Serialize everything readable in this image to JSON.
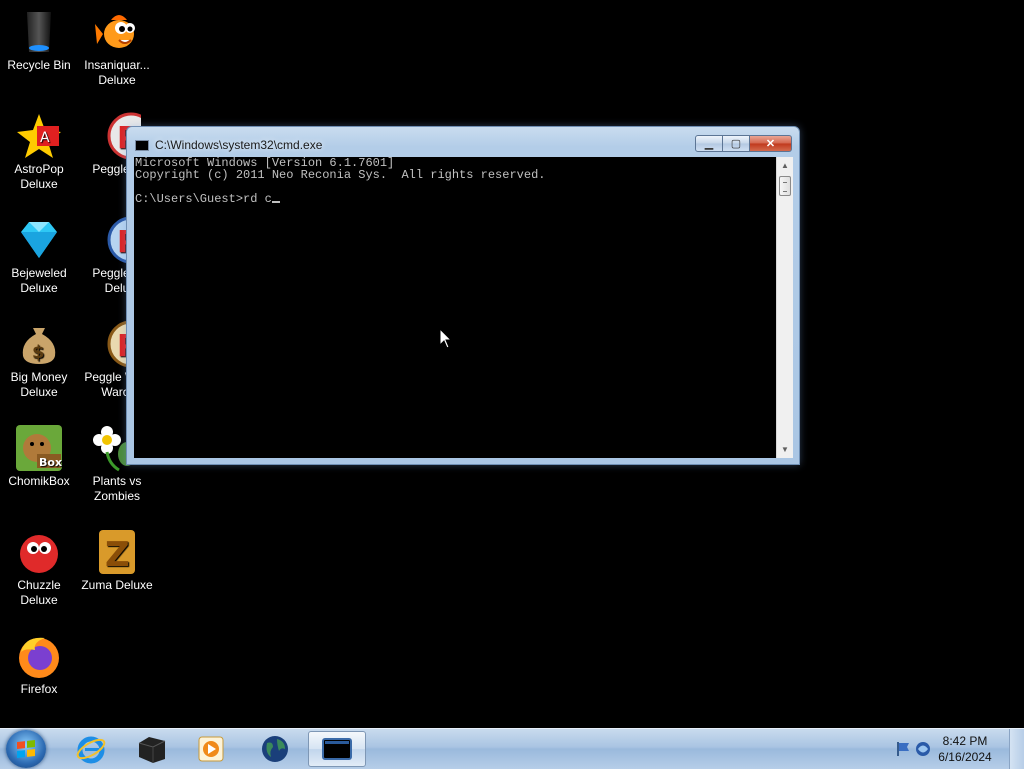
{
  "desktop": {
    "icons": [
      {
        "label": "Recycle Bin",
        "icon": "recycle-bin-icon"
      },
      {
        "label": "Insaniquar... Deluxe",
        "icon": "goldfish-icon"
      },
      {
        "label": "AstroPop Deluxe",
        "icon": "astropop-icon"
      },
      {
        "label": "Peggle D",
        "icon": "peggle-icon"
      },
      {
        "label": "Bejeweled Deluxe",
        "icon": "diamond-icon"
      },
      {
        "label": "Peggle N Delu",
        "icon": "peggle-nights-icon"
      },
      {
        "label": "Big Money Deluxe",
        "icon": "money-bag-icon"
      },
      {
        "label": "Peggle W of Warcr",
        "icon": "peggle-wow-icon"
      },
      {
        "label": "ChomikBox",
        "icon": "hamster-box-icon"
      },
      {
        "label": "Plants vs Zombies",
        "icon": "flower-icon"
      },
      {
        "label": "Chuzzle Deluxe",
        "icon": "chuzzle-icon"
      },
      {
        "label": "Zuma Deluxe",
        "icon": "zuma-icon"
      },
      {
        "label": "Firefox",
        "icon": "firefox-icon"
      }
    ]
  },
  "cmd_window": {
    "title": "C:\\Windows\\system32\\cmd.exe",
    "lines": [
      "Microsoft Windows [Version 6.1.7601]",
      "Copyright (c) 2011 Neo Reconia Sys.  All rights reserved.",
      "",
      "C:\\Users\\Guest>rd c"
    ],
    "buttons": {
      "minimize": "minimize",
      "maximize": "maximize",
      "close": "close"
    }
  },
  "taskbar": {
    "items": [
      {
        "name": "internet-explorer",
        "icon": "ie-icon"
      },
      {
        "name": "dark-app",
        "icon": "box-icon"
      },
      {
        "name": "media-player",
        "icon": "media-player-icon"
      },
      {
        "name": "globe-app",
        "icon": "globe-icon"
      },
      {
        "name": "cmd",
        "icon": "cmd-icon",
        "active": true
      }
    ],
    "clock": {
      "time": "8:42 PM",
      "date": "6/16/2024"
    }
  }
}
